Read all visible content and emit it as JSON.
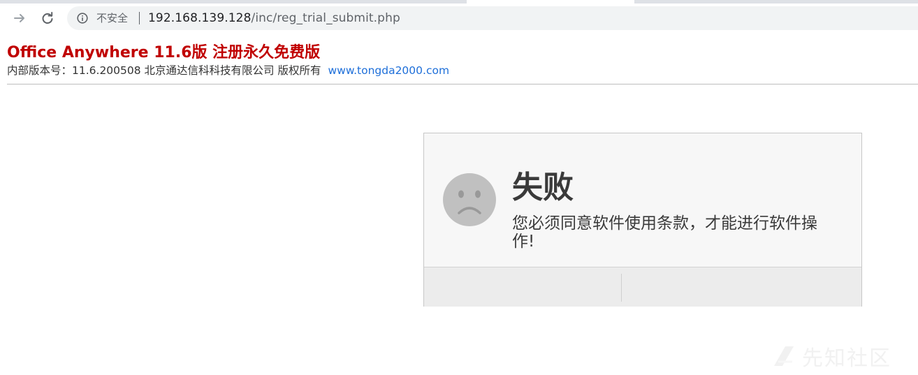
{
  "browser": {
    "security_label": "不安全",
    "url_host": "192.168.139.128",
    "url_path": "/inc/reg_trial_submit.php",
    "icons": {
      "forward": "arrow-right-icon",
      "reload": "reload-icon",
      "info": "info-icon"
    }
  },
  "header": {
    "title": "Office Anywhere 11.6版 注册永久免费版",
    "subtitle": "内部版本号：11.6.200508  北京通达信科科技有限公司 版权所有",
    "link_text": "www.tongda2000.com",
    "title_color": "#c00000",
    "link_color": "#1e6fd9"
  },
  "message": {
    "title": "失败",
    "text": "您必须同意软件使用条款，才能进行软件操作!",
    "icon": "sad-face-icon"
  },
  "watermark": {
    "logo": "xianzhi-logo-icon",
    "text": "先知社区"
  }
}
